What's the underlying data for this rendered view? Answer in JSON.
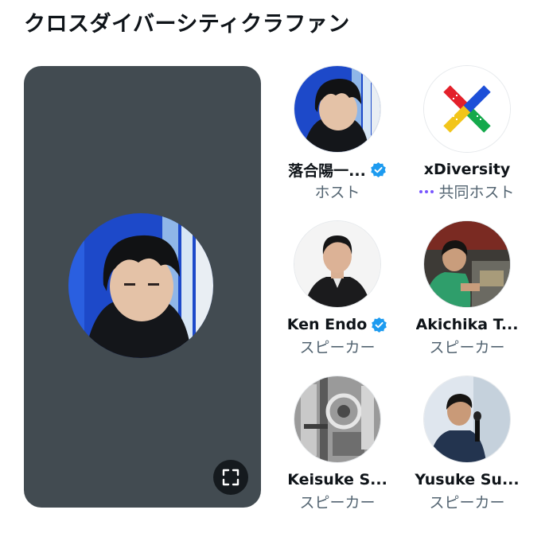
{
  "space": {
    "title": "クロスダイバーシティクラファン"
  },
  "speaker_view": {
    "avatar_icon": "person-photo-icon",
    "fullscreen_icon": "expand-icon"
  },
  "participants": [
    {
      "name": "落合陽一...",
      "role": "ホスト",
      "verified": true,
      "speaking": false
    },
    {
      "name": "xDiversity",
      "role": "共同ホスト",
      "verified": false,
      "speaking": true
    },
    {
      "name": "Ken Endo",
      "role": "スピーカー",
      "verified": true,
      "speaking": false
    },
    {
      "name": "Akichika T...",
      "role": "スピーカー",
      "verified": false,
      "speaking": false
    },
    {
      "name": "Keisuke S...",
      "role": "スピーカー",
      "verified": false,
      "speaking": false
    },
    {
      "name": "Yusuke Su...",
      "role": "スピーカー",
      "verified": false,
      "speaking": false
    }
  ],
  "colors": {
    "panel_bg": "#424b51",
    "verified_blue": "#1d9bf0",
    "speaking_purple": "#7856ff",
    "role_gray": "#536471"
  }
}
